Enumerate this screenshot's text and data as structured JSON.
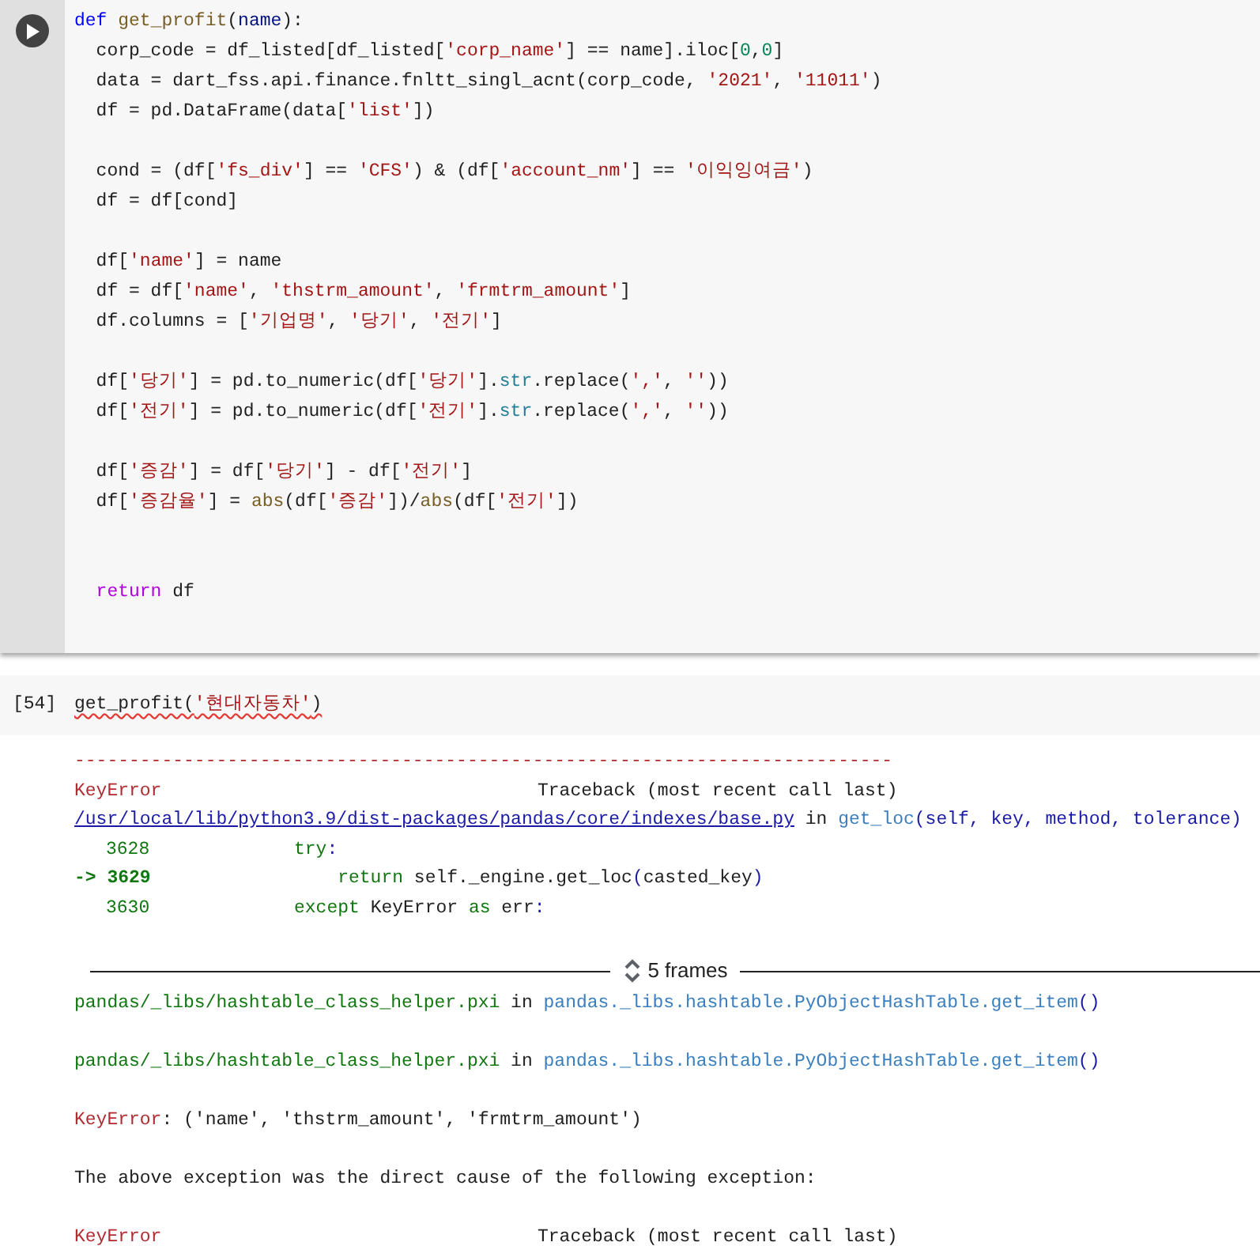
{
  "code_cell": {
    "run_button": true,
    "lines": [
      {
        "kind": "code",
        "tokens": [
          {
            "t": "def",
            "color": "#0000ff"
          },
          {
            "t": " get_profit",
            "color": "#795e26"
          },
          {
            "t": "(",
            "color": "#212121"
          },
          {
            "t": "name",
            "color": "#001080"
          },
          {
            "t": "):",
            "color": "#212121"
          }
        ]
      },
      {
        "kind": "code",
        "tokens": [
          {
            "t": "  corp_code = df_listed[df_listed[",
            "color": "#212121"
          },
          {
            "t": "'corp_name'",
            "color": "#a31515"
          },
          {
            "t": "] == name].iloc[",
            "color": "#212121"
          },
          {
            "t": "0",
            "color": "#098658"
          },
          {
            "t": ",",
            "color": "#212121"
          },
          {
            "t": "0",
            "color": "#098658"
          },
          {
            "t": "]",
            "color": "#212121"
          }
        ]
      },
      {
        "kind": "code",
        "tokens": [
          {
            "t": "  data = dart_fss.api.finance.fnltt_singl_acnt(corp_code, ",
            "color": "#212121"
          },
          {
            "t": "'2021'",
            "color": "#a31515"
          },
          {
            "t": ", ",
            "color": "#212121"
          },
          {
            "t": "'11011'",
            "color": "#a31515"
          },
          {
            "t": ")",
            "color": "#212121"
          }
        ]
      },
      {
        "kind": "code",
        "tokens": [
          {
            "t": "  df = pd.DataFrame(data[",
            "color": "#212121"
          },
          {
            "t": "'list'",
            "color": "#a31515"
          },
          {
            "t": "])",
            "color": "#212121"
          }
        ]
      },
      {
        "kind": "blank"
      },
      {
        "kind": "code",
        "tokens": [
          {
            "t": "  cond = (df[",
            "color": "#212121"
          },
          {
            "t": "'fs_div'",
            "color": "#a31515"
          },
          {
            "t": "] == ",
            "color": "#212121"
          },
          {
            "t": "'CFS'",
            "color": "#a31515"
          },
          {
            "t": ") & (df[",
            "color": "#212121"
          },
          {
            "t": "'account_nm'",
            "color": "#a31515"
          },
          {
            "t": "] == ",
            "color": "#212121"
          },
          {
            "t": "'이익잉여금'",
            "color": "#a31515"
          },
          {
            "t": ")",
            "color": "#212121"
          }
        ]
      },
      {
        "kind": "code",
        "tokens": [
          {
            "t": "  df = df[cond]",
            "color": "#212121"
          }
        ]
      },
      {
        "kind": "blank"
      },
      {
        "kind": "code",
        "tokens": [
          {
            "t": "  df[",
            "color": "#212121"
          },
          {
            "t": "'name'",
            "color": "#a31515"
          },
          {
            "t": "] = name",
            "color": "#212121"
          }
        ]
      },
      {
        "kind": "code",
        "tokens": [
          {
            "t": "  df = df[",
            "color": "#212121"
          },
          {
            "t": "'name'",
            "color": "#a31515"
          },
          {
            "t": ", ",
            "color": "#212121"
          },
          {
            "t": "'thstrm_amount'",
            "color": "#a31515"
          },
          {
            "t": ", ",
            "color": "#212121"
          },
          {
            "t": "'frmtrm_amount'",
            "color": "#a31515"
          },
          {
            "t": "]",
            "color": "#212121"
          }
        ]
      },
      {
        "kind": "code",
        "tokens": [
          {
            "t": "  df.columns = [",
            "color": "#212121"
          },
          {
            "t": "'기업명'",
            "color": "#a31515"
          },
          {
            "t": ", ",
            "color": "#212121"
          },
          {
            "t": "'당기'",
            "color": "#a31515"
          },
          {
            "t": ", ",
            "color": "#212121"
          },
          {
            "t": "'전기'",
            "color": "#a31515"
          },
          {
            "t": "]",
            "color": "#212121"
          }
        ]
      },
      {
        "kind": "blank"
      },
      {
        "kind": "code",
        "tokens": [
          {
            "t": "  df[",
            "color": "#212121"
          },
          {
            "t": "'당기'",
            "color": "#a31515"
          },
          {
            "t": "] = pd.to_numeric(df[",
            "color": "#212121"
          },
          {
            "t": "'당기'",
            "color": "#a31515"
          },
          {
            "t": "].",
            "color": "#212121"
          },
          {
            "t": "str",
            "color": "#267f99"
          },
          {
            "t": ".replace(",
            "color": "#212121"
          },
          {
            "t": "','",
            "color": "#a31515"
          },
          {
            "t": ", ",
            "color": "#212121"
          },
          {
            "t": "''",
            "color": "#a31515"
          },
          {
            "t": "))",
            "color": "#212121"
          }
        ]
      },
      {
        "kind": "code",
        "tokens": [
          {
            "t": "  df[",
            "color": "#212121"
          },
          {
            "t": "'전기'",
            "color": "#a31515"
          },
          {
            "t": "] = pd.to_numeric(df[",
            "color": "#212121"
          },
          {
            "t": "'전기'",
            "color": "#a31515"
          },
          {
            "t": "].",
            "color": "#212121"
          },
          {
            "t": "str",
            "color": "#267f99"
          },
          {
            "t": ".replace(",
            "color": "#212121"
          },
          {
            "t": "','",
            "color": "#a31515"
          },
          {
            "t": ", ",
            "color": "#212121"
          },
          {
            "t": "''",
            "color": "#a31515"
          },
          {
            "t": "))",
            "color": "#212121"
          }
        ]
      },
      {
        "kind": "blank"
      },
      {
        "kind": "code",
        "tokens": [
          {
            "t": "  df[",
            "color": "#212121"
          },
          {
            "t": "'증감'",
            "color": "#a31515"
          },
          {
            "t": "] = df[",
            "color": "#212121"
          },
          {
            "t": "'당기'",
            "color": "#a31515"
          },
          {
            "t": "] - df[",
            "color": "#212121"
          },
          {
            "t": "'전기'",
            "color": "#a31515"
          },
          {
            "t": "]",
            "color": "#212121"
          }
        ]
      },
      {
        "kind": "code",
        "tokens": [
          {
            "t": "  df[",
            "color": "#212121"
          },
          {
            "t": "'증감율'",
            "color": "#a31515"
          },
          {
            "t": "] = ",
            "color": "#212121"
          },
          {
            "t": "abs",
            "color": "#795e26"
          },
          {
            "t": "(df[",
            "color": "#212121"
          },
          {
            "t": "'증감'",
            "color": "#a31515"
          },
          {
            "t": "])/",
            "color": "#212121"
          },
          {
            "t": "abs",
            "color": "#795e26"
          },
          {
            "t": "(df[",
            "color": "#212121"
          },
          {
            "t": "'전기'",
            "color": "#a31515"
          },
          {
            "t": "])",
            "color": "#212121"
          }
        ]
      },
      {
        "kind": "blank"
      },
      {
        "kind": "blank"
      },
      {
        "kind": "code",
        "tokens": [
          {
            "t": "  return",
            "color": "#af00db"
          },
          {
            "t": " df",
            "color": "#212121"
          }
        ]
      }
    ]
  },
  "run_cell": {
    "prompt": "[54]",
    "flagged": true,
    "tokens": [
      {
        "t": "get_profit(",
        "color": "#212121"
      },
      {
        "t": "'현대자동차'",
        "color": "#a31515"
      },
      {
        "t": ")",
        "color": "#212121"
      }
    ]
  },
  "output": [
    {
      "kind": "rule",
      "text": "---------------------------------------------------------------------------"
    },
    {
      "kind": "header",
      "error": "KeyError",
      "traceback": "Traceback (most recent call last)"
    },
    {
      "kind": "location",
      "linked": true,
      "file": "/usr/local/lib/python3.9/dist-packages/pandas/core/indexes/base.py",
      "sep": " in ",
      "func": "get_loc",
      "args": "(self, key, method, tolerance)"
    },
    {
      "kind": "source",
      "arrow": false,
      "number": "3628",
      "tokens": [
        {
          "t": "try",
          "color": "#117711"
        },
        {
          "t": ":",
          "color": "#1a1aa6"
        }
      ]
    },
    {
      "kind": "source",
      "arrow": true,
      "number": "-> 3629",
      "tokens": [
        {
          "t": "    return",
          "color": "#117711"
        },
        {
          "t": " self._engine.get_loc",
          "color": "#212121"
        },
        {
          "t": "(",
          "color": "#1a1aa6"
        },
        {
          "t": "casted_key",
          "color": "#212121"
        },
        {
          "t": ")",
          "color": "#1a1aa6"
        }
      ]
    },
    {
      "kind": "source",
      "arrow": false,
      "number": "3630",
      "tokens": [
        {
          "t": "except",
          "color": "#117711"
        },
        {
          "t": " KeyError ",
          "color": "#212121"
        },
        {
          "t": "as",
          "color": "#117711"
        },
        {
          "t": " err",
          "color": "#212121"
        },
        {
          "t": ":",
          "color": "#1a1aa6"
        }
      ]
    },
    {
      "kind": "blank"
    },
    {
      "kind": "frames",
      "label": "5 frames"
    },
    {
      "kind": "location",
      "linked": false,
      "file": "pandas/_libs/hashtable_class_helper.pxi",
      "sep": " in ",
      "func": "pandas._libs.hashtable.PyObjectHashTable.get_item",
      "args": "()"
    },
    {
      "kind": "blank"
    },
    {
      "kind": "location",
      "linked": false,
      "file": "pandas/_libs/hashtable_class_helper.pxi",
      "sep": " in ",
      "func": "pandas._libs.hashtable.PyObjectHashTable.get_item",
      "args": "()"
    },
    {
      "kind": "blank"
    },
    {
      "kind": "message",
      "error": "KeyError",
      "text": ": ('name', 'thstrm_amount', 'frmtrm_amount')"
    },
    {
      "kind": "blank"
    },
    {
      "kind": "text",
      "text": "The above exception was the direct cause of the following exception:"
    },
    {
      "kind": "blank"
    },
    {
      "kind": "header",
      "error": "KeyError",
      "traceback": "Traceback (most recent call last)"
    }
  ]
}
